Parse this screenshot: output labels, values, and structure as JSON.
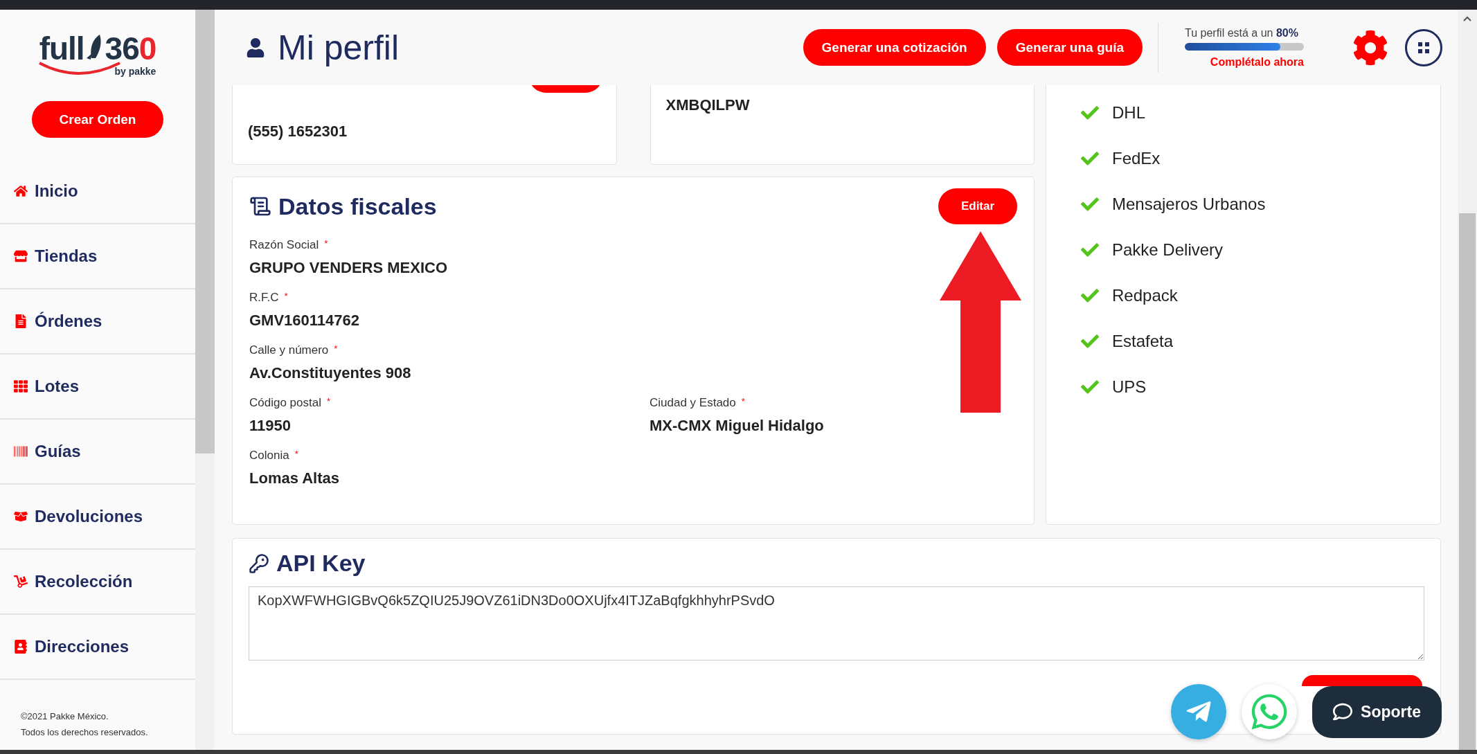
{
  "logo": {
    "word": "full",
    "digits": "36",
    "accent": "0",
    "tagline": "by pakke"
  },
  "create_order_button": "Crear Orden",
  "sidebar": {
    "items": [
      {
        "label": "Inicio"
      },
      {
        "label": "Tiendas"
      },
      {
        "label": "Órdenes"
      },
      {
        "label": "Lotes"
      },
      {
        "label": "Guías"
      },
      {
        "label": "Devoluciones"
      },
      {
        "label": "Recolección"
      },
      {
        "label": "Direcciones"
      }
    ]
  },
  "footer": [
    "©2021 Pakke México.",
    "Todos los derechos reservados."
  ],
  "header": {
    "title": "Mi perfil",
    "buttons": [
      "Generar una cotización",
      "Generar una guía"
    ],
    "profile_progress": {
      "text": "Tu perfil está a un **80%**",
      "level": 0.8,
      "link": "Complétalo ahora"
    }
  },
  "contact_card": {
    "phone": "(555) 1652301"
  },
  "code_card": {
    "value": "XMBQILPW"
  },
  "carriers": [
    {
      "name": "DHL",
      "checked": true
    },
    {
      "name": "FedEx",
      "checked": true
    },
    {
      "name": "Mensajeros Urbanos",
      "checked": true
    },
    {
      "name": "Pakke Delivery",
      "checked": true
    },
    {
      "name": "Redpack",
      "checked": true
    },
    {
      "name": "Estafeta",
      "checked": true
    },
    {
      "name": "UPS",
      "checked": true
    }
  ],
  "fiscal": {
    "title": "Datos fiscales",
    "edit_button": "Editar",
    "rows": [
      [
        {
          "label": "Razón Social",
          "required_mark": "*",
          "value": "GRUPO VENDERS MEXICO"
        }
      ],
      [
        {
          "label": "R.F.C",
          "required_mark": "*",
          "value": "GMV160114762"
        }
      ],
      [
        {
          "label": "Calle y número",
          "required_mark": "*",
          "value": "Av.Constituyentes 908"
        }
      ],
      [
        {
          "label": "Código postal",
          "required_mark": "*",
          "value": "11950"
        },
        {
          "label": "Ciudad y Estado",
          "required_mark": "*",
          "value": "MX-CMX Miguel Hidalgo"
        }
      ],
      [
        {
          "label": "Colonia",
          "required_mark": "*",
          "value": "Lomas Altas"
        }
      ]
    ]
  },
  "api_key": {
    "title": "API Key",
    "value": "KopXWFWHGIGBvQ6k5ZQIU25J9OVZ61iDN3Do0OXUjfx4ITJZaBqfgkhhyhrPSvdO"
  },
  "support": {
    "label": "Soporte"
  }
}
